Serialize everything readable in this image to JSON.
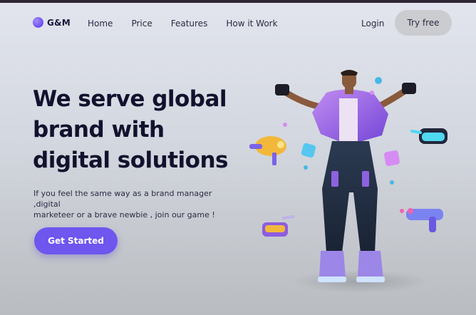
{
  "brand": {
    "name": "G&M"
  },
  "nav": {
    "items": [
      {
        "label": "Home"
      },
      {
        "label": "Price"
      },
      {
        "label": "Features"
      },
      {
        "label": "How it Work"
      }
    ],
    "login_label": "Login",
    "try_label": "Try free"
  },
  "hero": {
    "headline_lines": [
      "We serve global",
      "brand with",
      "digital solutions"
    ],
    "subtext_lines": [
      "If you feel the same way as a brand manager ,digital",
      "marketeer or a brave newbie , join our game !"
    ],
    "cta_label": "Get Started"
  },
  "colors": {
    "accent": "#6e56ee",
    "heading": "#12122e",
    "background": "#dfe2ea"
  },
  "illustration": {
    "items": [
      "character-3d",
      "vr-headset-icon",
      "raygun-icon",
      "blaster-icon",
      "cube-icon"
    ]
  }
}
